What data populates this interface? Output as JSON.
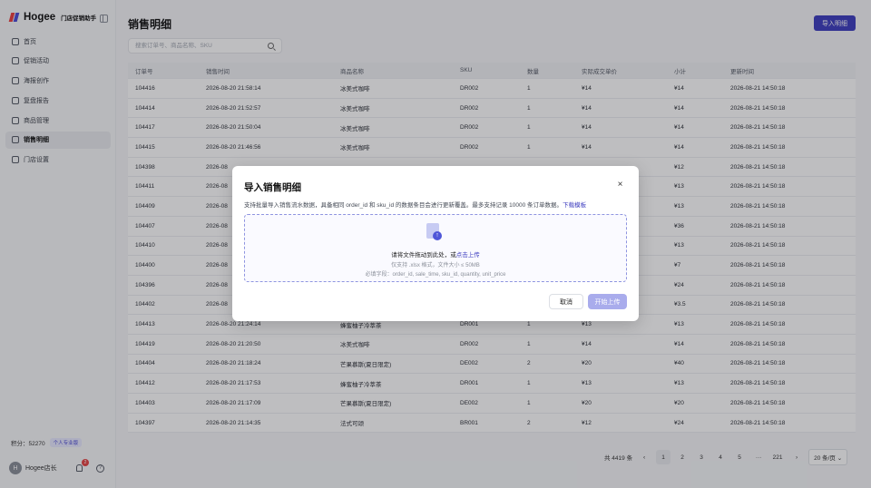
{
  "sidebar": {
    "brand_name": "Hogee",
    "brand_sub": "门店促销助手",
    "items": [
      {
        "label": "首页",
        "icon": "home-icon"
      },
      {
        "label": "促销活动",
        "icon": "gift-icon"
      },
      {
        "label": "海报创作",
        "icon": "image-icon"
      },
      {
        "label": "复盘报告",
        "icon": "report-icon"
      },
      {
        "label": "商品管理",
        "icon": "box-icon"
      },
      {
        "label": "销售明细",
        "icon": "document-icon",
        "active": true
      },
      {
        "label": "门店设置",
        "icon": "store-icon"
      }
    ],
    "points_label": "积分：",
    "points_value": "52270",
    "plan_tag": "个人专业版",
    "user_name": "Hogee店长",
    "avatar_letter": "H",
    "notification_count": "2"
  },
  "main": {
    "title": "销售明细",
    "import_button": "导入明细",
    "search_placeholder": "搜索订单号、商品名称、SKU",
    "columns": [
      "订单号",
      "销售时间",
      "商品名称",
      "SKU",
      "数量",
      "实际成交单价",
      "小计",
      "更新时间"
    ],
    "rows": [
      [
        "104416",
        "2026-08-20 21:58:14",
        "冰美式咖啡",
        "DR002",
        "1",
        "¥14",
        "¥14",
        "2026-08-21 14:50:18"
      ],
      [
        "104414",
        "2026-08-20 21:52:57",
        "冰美式咖啡",
        "DR002",
        "1",
        "¥14",
        "¥14",
        "2026-08-21 14:50:18"
      ],
      [
        "104417",
        "2026-08-20 21:50:04",
        "冰美式咖啡",
        "DR002",
        "1",
        "¥14",
        "¥14",
        "2026-08-21 14:50:18"
      ],
      [
        "104415",
        "2026-08-20 21:46:56",
        "冰美式咖啡",
        "DR002",
        "1",
        "¥14",
        "¥14",
        "2026-08-21 14:50:18"
      ],
      [
        "104398",
        "2026-08",
        "",
        "",
        "",
        "",
        "¥12",
        "2026-08-21 14:50:18"
      ],
      [
        "104411",
        "2026-08",
        "",
        "",
        "",
        "",
        "¥13",
        "2026-08-21 14:50:18"
      ],
      [
        "104409",
        "2026-08",
        "",
        "",
        "",
        "",
        "¥13",
        "2026-08-21 14:50:18"
      ],
      [
        "104407",
        "2026-08",
        "",
        "",
        "",
        "",
        "¥36",
        "2026-08-21 14:50:18"
      ],
      [
        "104410",
        "2026-08",
        "",
        "",
        "",
        "",
        "¥13",
        "2026-08-21 14:50:18"
      ],
      [
        "104400",
        "2026-08",
        "",
        "",
        "",
        "",
        "¥7",
        "2026-08-21 14:50:18"
      ],
      [
        "104396",
        "2026-08",
        "",
        "",
        "",
        "",
        "¥24",
        "2026-08-21 14:50:18"
      ],
      [
        "104402",
        "2026-08",
        "",
        "",
        "",
        "",
        "¥3.5",
        "2026-08-21 14:50:18"
      ],
      [
        "104413",
        "2026-08-20 21:24:14",
        "蜂蜜柚子冷萃茶",
        "DR001",
        "1",
        "¥13",
        "¥13",
        "2026-08-21 14:50:18"
      ],
      [
        "104419",
        "2026-08-20 21:20:50",
        "冰美式咖啡",
        "DR002",
        "1",
        "¥14",
        "¥14",
        "2026-08-21 14:50:18"
      ],
      [
        "104404",
        "2026-08-20 21:18:24",
        "芒果慕斯(夏日限定)",
        "DE002",
        "2",
        "¥20",
        "¥40",
        "2026-08-21 14:50:18"
      ],
      [
        "104412",
        "2026-08-20 21:17:53",
        "蜂蜜柚子冷萃茶",
        "DR001",
        "1",
        "¥13",
        "¥13",
        "2026-08-21 14:50:18"
      ],
      [
        "104403",
        "2026-08-20 21:17:09",
        "芒果慕斯(夏日限定)",
        "DE002",
        "1",
        "¥20",
        "¥20",
        "2026-08-21 14:50:18"
      ],
      [
        "104397",
        "2026-08-20 21:14:35",
        "法式可颂",
        "BR001",
        "2",
        "¥12",
        "¥24",
        "2026-08-21 14:50:18"
      ]
    ],
    "pagination": {
      "total": "共 4419 条",
      "prev": "‹",
      "pages": [
        "1",
        "2",
        "3",
        "4",
        "5"
      ],
      "ellipsis": "···",
      "last": "221",
      "next": "›",
      "page_size": "20 条/页 ⌄"
    }
  },
  "modal": {
    "title": "导入销售明细",
    "desc": "支持批量导入销售流水数据，具备相同 order_id 和 sku_id 的数据条目会进行更新覆盖。最多支持记录 10000 条订单数据。",
    "template_link": "下载模板",
    "drop_text": "请将文件拖动到此处，或",
    "drop_link": "点击上传",
    "drop_hint": "仅支持 .xlsx 格式，文件大小 ≤ 50MB",
    "required_fields": "必填字段：order_id, sale_time, sku_id, quantity, unit_price",
    "cancel": "取消",
    "start": "开始上传"
  }
}
